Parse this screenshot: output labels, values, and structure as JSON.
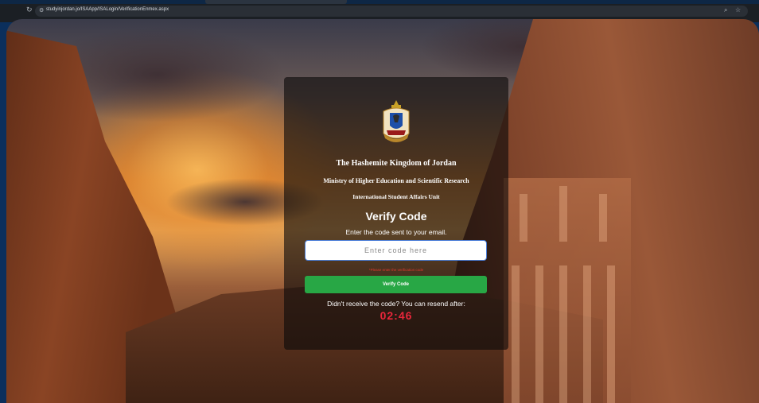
{
  "browser": {
    "url": "studyinjordan.jo/ISAApp/ISALogin/VerificationEnmex.aspx"
  },
  "emblem": {
    "name": "jordan-coat-of-arms"
  },
  "dialog": {
    "line1": "The Hashemite Kingdom of Jordan",
    "line2": "Ministry of Higher Education and Scientific Research",
    "line3": "International Student Affairs Unit",
    "title": "Verify Code",
    "instruction": "Enter the code sent to your email.",
    "input_placeholder": "Enter code here",
    "error": "*Please enter the verification code",
    "verify_label": "Verify Code",
    "resend_text": "Didn't receive the code? You can resend after:",
    "timer": "02:46"
  },
  "colors": {
    "button": "#28a745",
    "timer": "#e8263a",
    "error": "#e23a2e"
  }
}
